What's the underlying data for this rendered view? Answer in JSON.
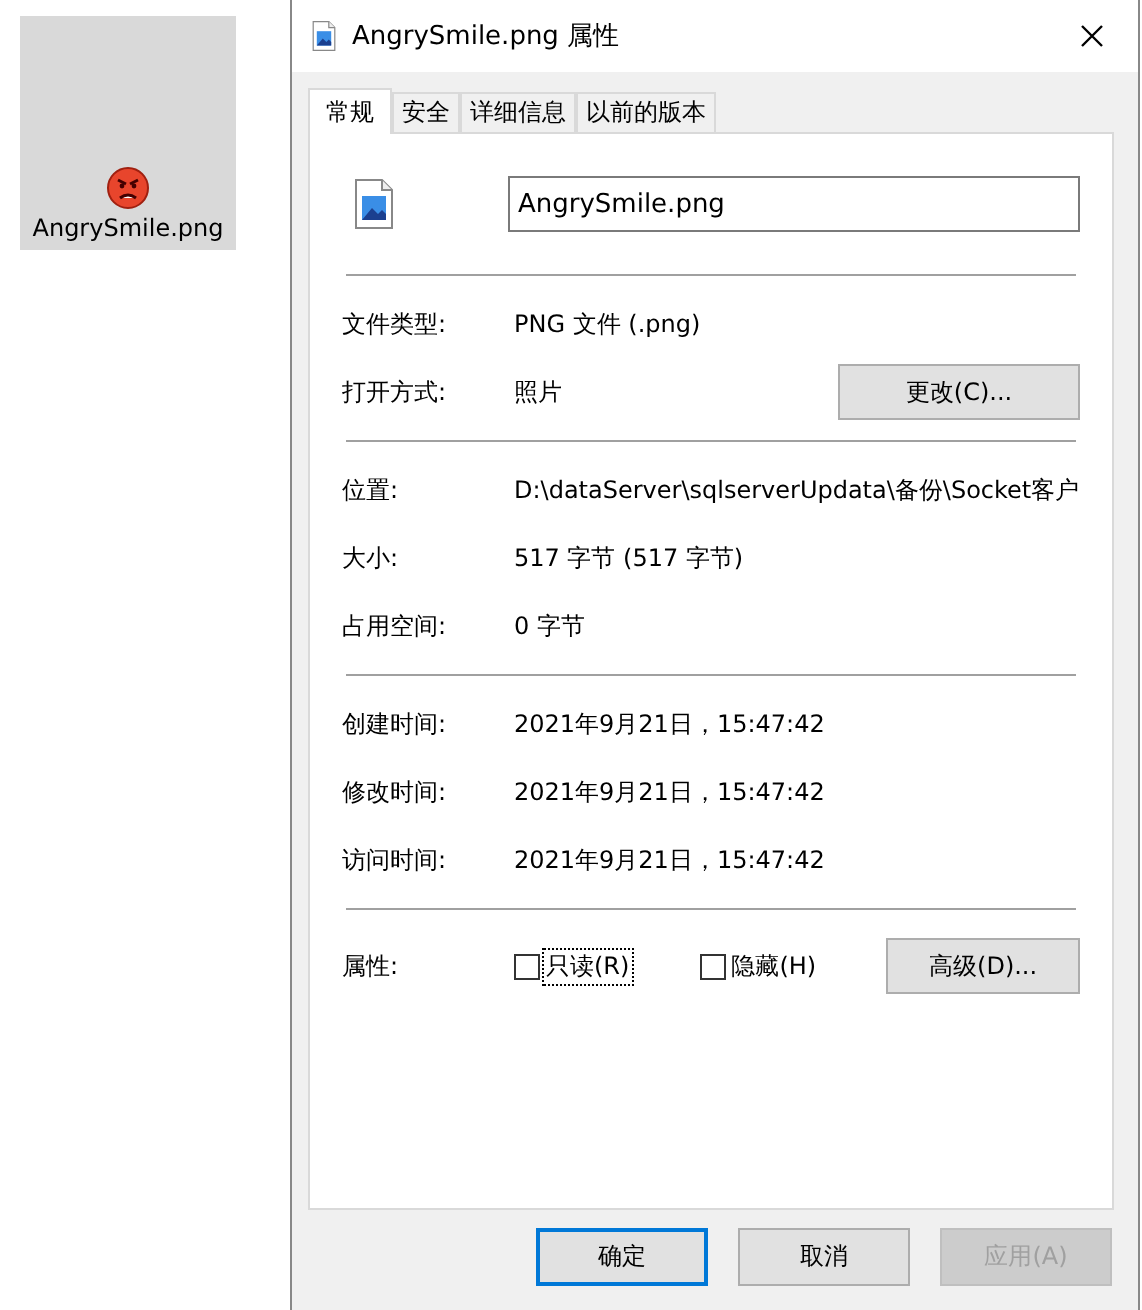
{
  "desktop_icon": {
    "label": "AngrySmile.png",
    "selected": true
  },
  "window": {
    "title": "AngrySmile.png 属性"
  },
  "tabs": [
    {
      "label": "常规",
      "selected": true
    },
    {
      "label": "安全",
      "selected": false
    },
    {
      "label": "详细信息",
      "selected": false
    },
    {
      "label": "以前的版本",
      "selected": false
    }
  ],
  "file_name": {
    "value": "AngrySmile.png"
  },
  "sections": [
    [
      {
        "label": "文件类型:",
        "value": "PNG 文件 (.png)"
      },
      {
        "label": "打开方式:",
        "value": "照片",
        "button": "更改(C)..."
      }
    ],
    [
      {
        "label": "位置:",
        "value": "D:\\dataServer\\sqlserverUpdata\\备份\\Socket客户"
      },
      {
        "label": "大小:",
        "value": "517 字节 (517 字节)"
      },
      {
        "label": "占用空间:",
        "value": "0 字节"
      }
    ],
    [
      {
        "label": "创建时间:",
        "value": "2021年9月21日，15:47:42"
      },
      {
        "label": "修改时间:",
        "value": "2021年9月21日，15:47:42"
      },
      {
        "label": "访问时间:",
        "value": "2021年9月21日，15:47:42"
      }
    ]
  ],
  "attributes": {
    "label": "属性:",
    "checkboxes": [
      {
        "label": "只读(R)",
        "checked": false,
        "focused": true
      },
      {
        "label": "隐藏(H)",
        "checked": false,
        "focused": false
      }
    ],
    "button": "高级(D)..."
  },
  "buttons": [
    {
      "label": "确定",
      "kind": "default",
      "disabled": false
    },
    {
      "label": "取消",
      "kind": "normal",
      "disabled": false
    },
    {
      "label": "应用(A)",
      "kind": "normal",
      "disabled": true
    }
  ]
}
